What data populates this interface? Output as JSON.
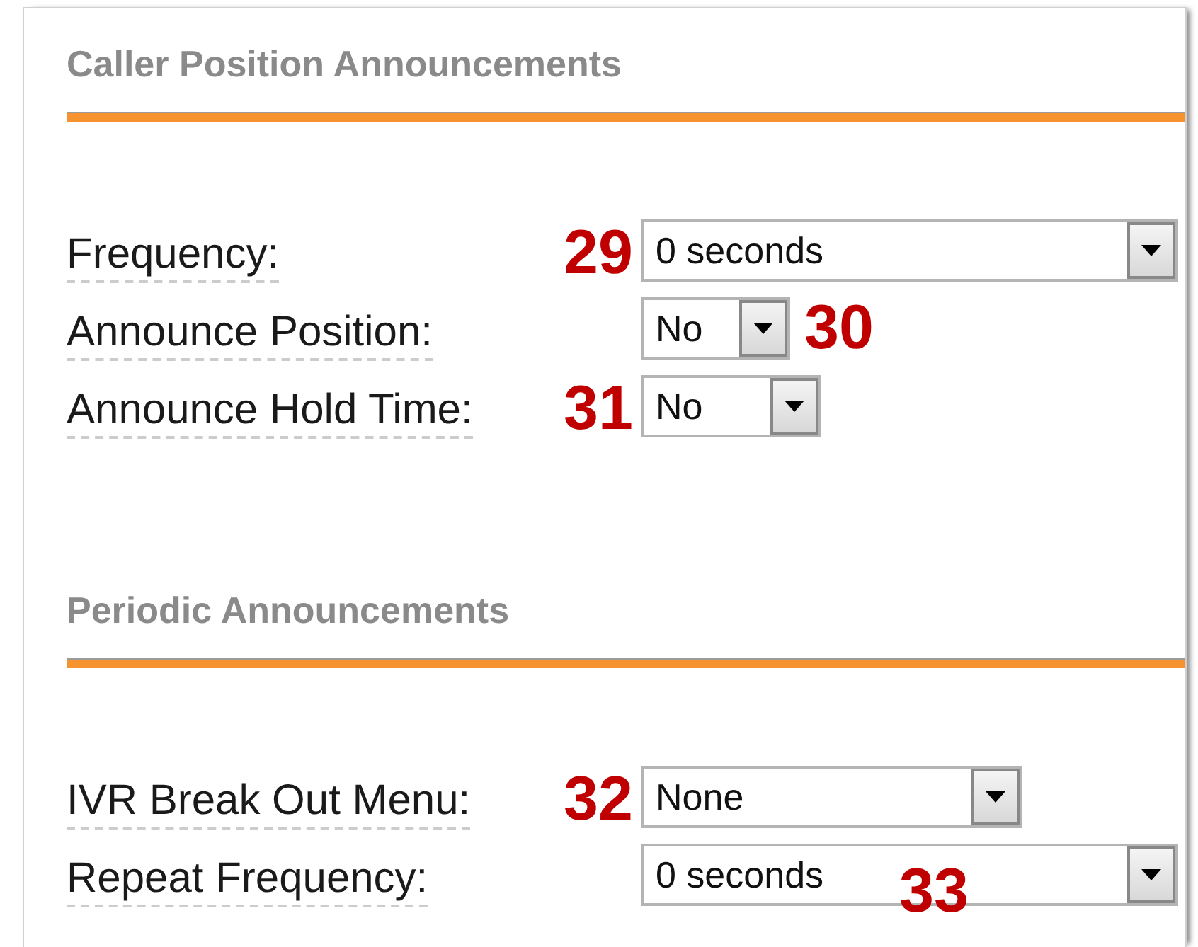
{
  "sections": [
    {
      "title": "Caller Position Announcements",
      "fields": [
        {
          "label": "Frequency:",
          "value": "0 seconds",
          "annotation": {
            "text": "29",
            "kind": "before"
          }
        },
        {
          "label": "Announce Position:",
          "value": "No",
          "annotation": {
            "text": "30",
            "kind": "after"
          }
        },
        {
          "label": "Announce Hold Time:",
          "value": "No",
          "annotation": {
            "text": "31",
            "kind": "before"
          }
        }
      ]
    },
    {
      "title": "Periodic Announcements",
      "fields": [
        {
          "label": "IVR Break Out Menu:",
          "value": "None",
          "annotation": {
            "text": "32",
            "kind": "before"
          }
        },
        {
          "label": "Repeat Frequency:",
          "value": "0 seconds",
          "annotation": {
            "text": "33",
            "kind": "over"
          }
        }
      ]
    }
  ]
}
